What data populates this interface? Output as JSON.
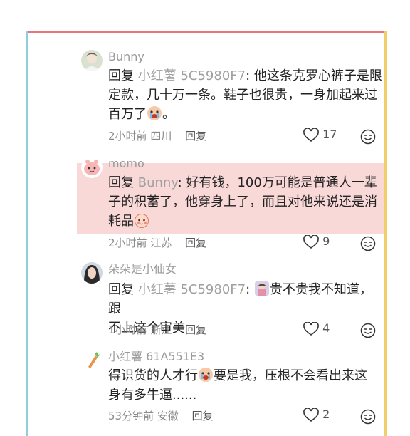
{
  "comments": [
    {
      "username": "Bunny",
      "reply_word": "回复",
      "reply_to": "小红薯 5C5980F7",
      "text_line1": ": 他这条克罗心裤子是限",
      "text_line2": "定款，几十万一条。鞋子也很贵，一身加起来过",
      "text_line3": "百万了",
      "text_tail": "。",
      "time": "2小时前",
      "location": "四川",
      "reply_label": "回复",
      "likes": "17"
    },
    {
      "username": "momo",
      "reply_word": "回复",
      "reply_to": "Bunny",
      "text_line1": ": 好有钱，100万可能是普通人一辈",
      "text_line2": "子的积蓄了，他穿身上了，而且对他来说还是消",
      "text_line3": "耗品",
      "time": "2小时前",
      "location": "江苏",
      "reply_label": "回复",
      "likes": "9"
    },
    {
      "username": "朵朵是小仙女",
      "reply_word": "回复",
      "reply_to": "小红薯 5C5980F7",
      "text_line1": ":",
      "text_line1b": "贵不贵我不知道，跟",
      "text_line2": "不上这个审美",
      "time": "1小时前",
      "location": "浙江",
      "reply_label": "回复",
      "likes": "4"
    },
    {
      "username": "小红薯 61A551E3",
      "text_line1": "得识货的人才行",
      "text_line1b": "要是我，压根不会看出来这",
      "text_line2": "身有多牛逼......",
      "time": "53分钟前",
      "location": "安徽",
      "reply_label": "回复",
      "likes": "2"
    }
  ],
  "colors": {
    "highlight": "#f9d8d8",
    "frame_top": "#e8737a",
    "frame_left": "#8fd0d8",
    "frame_right": "#f0cf6a"
  }
}
